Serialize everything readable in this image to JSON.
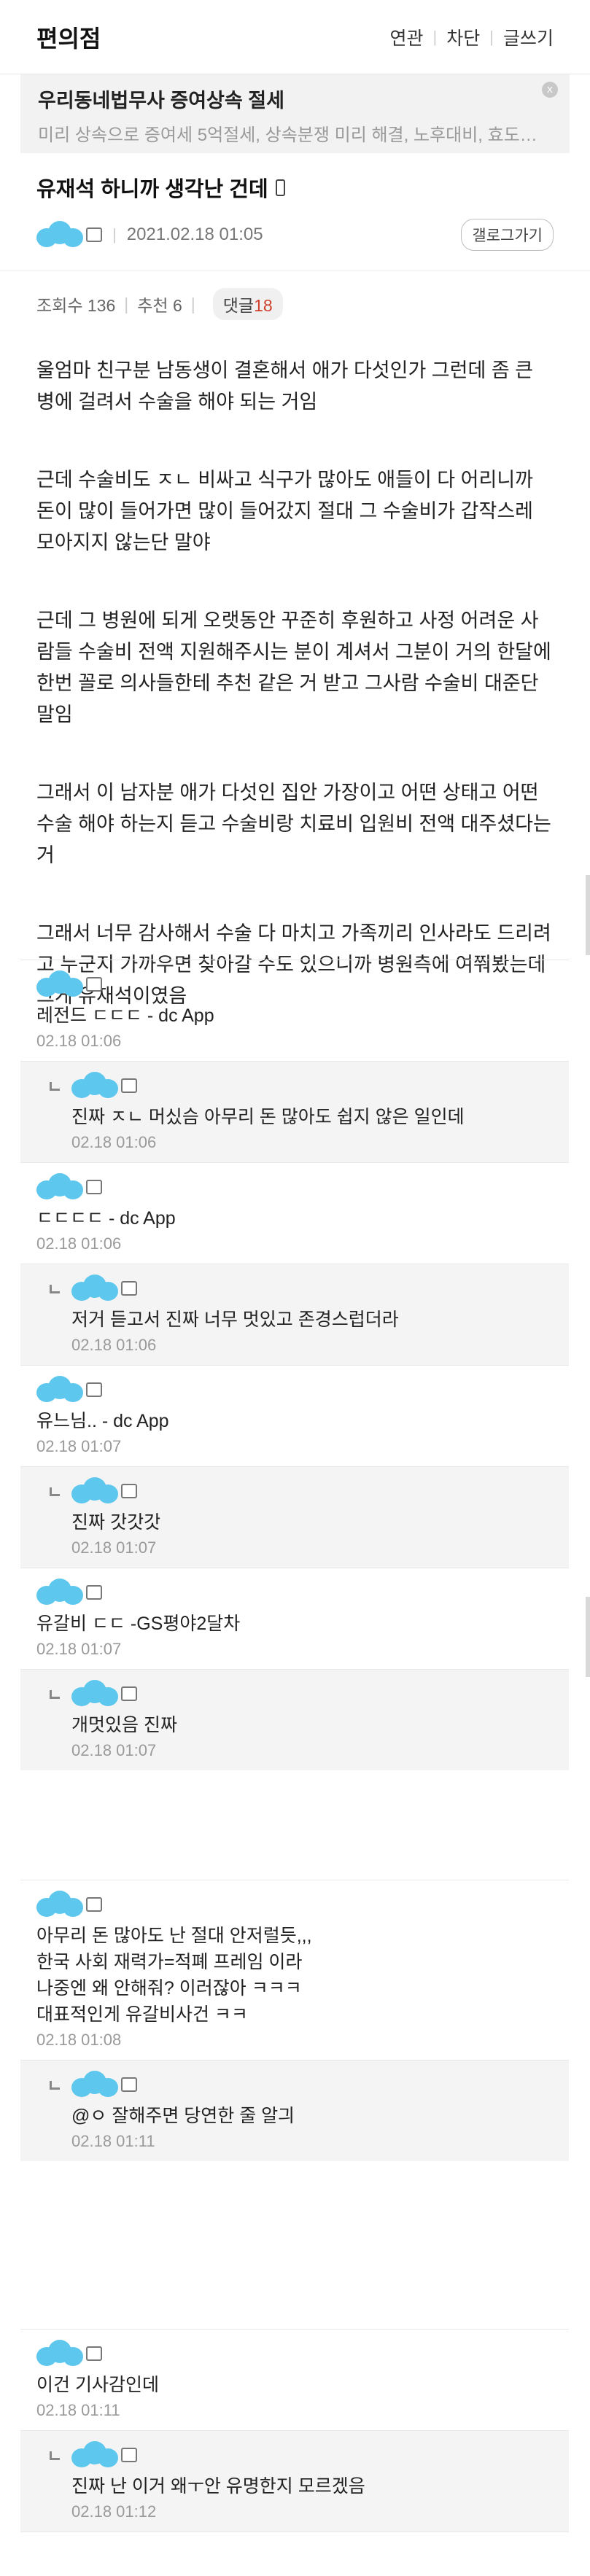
{
  "header": {
    "site_title": "편의점",
    "links": [
      "연관",
      "차단",
      "글쓰기"
    ]
  },
  "ad": {
    "title": "우리동네법무사 증여상속 절세",
    "desc": "미리 상속으로 증여세 5억절세, 상속분쟁 미리 해결, 노후대비, 효도…",
    "close": "x"
  },
  "post": {
    "title": "유재석 하니까 생각난 건데",
    "date": "2021.02.18 01:05",
    "gallery_button": "갤로그가기",
    "views": "조회수 136",
    "recommend": "추천 6",
    "reply_label": "댓글",
    "reply_count": "18",
    "body": [
      "울엄마 친구분 남동생이 결혼해서 애가 다섯인가 그런데 좀 큰 병에 걸려서 수술을 해야 되는 거임",
      "근데 수술비도 ㅈㄴ 비싸고 식구가 많아도 애들이 다 어리니까 돈이 많이 들어가면 많이 들어갔지 절대 그 수술비가 갑작스레 모아지지 않는단 말야",
      "근데 그 병원에 되게 오랫동안 꾸준히 후원하고 사정 어려운 사람들 수술비 전액 지원해주시는 분이 계셔서 그분이 거의 한달에 한번 꼴로 의사들한테 추천 같은 거 받고 그사람 수술비 대준단말임",
      "그래서 이 남자분 애가 다섯인 집안 가장이고 어떤 상태고 어떤 수술 해야 하는지 듣고 수술비랑 치료비 입원비 전액 대주셨다는거",
      "그래서 너무 감사해서 수술 다 마치고 가족끼리 인사라도 드리려고 누군지 가까우면 찾아갈 수도 있으니까 병원측에 여쭤봤는데 그게 유재석이였음"
    ]
  },
  "comments": [
    {
      "text": "레전드 ㄷㄷㄷ - dc App",
      "date": "02.18 01:06",
      "reply": false
    },
    {
      "text": "진짜 ㅈㄴ 머싰슴 아무리 돈 많아도 쉽지 않은 일인데",
      "date": "02.18 01:06",
      "reply": true
    },
    {
      "text": "ㄷㄷㄷㄷ - dc App",
      "date": "02.18 01:06",
      "reply": false
    },
    {
      "text": "저거 듣고서 진짜 너무 멋있고 존경스럽더라",
      "date": "02.18 01:06",
      "reply": true
    },
    {
      "text": "유느님.. - dc App",
      "date": "02.18 01:07",
      "reply": false
    },
    {
      "text": "진짜 갓갓갓",
      "date": "02.18 01:07",
      "reply": true
    },
    {
      "text": "유갈비 ㄷㄷ -GS평야2달차",
      "date": "02.18 01:07",
      "reply": false
    },
    {
      "text": "개멋있음 진짜",
      "date": "02.18 01:07",
      "reply": true
    },
    {
      "text": "아무리 돈 많아도 난 절대 안저럴듯,,,\n한국 사회 재력가=적폐 프레임 이라\n나중엔 왜 안해줘? 이러잖아 ㅋㅋㅋ\n대표적인게 유갈비사건 ㅋㅋ",
      "date": "02.18 01:08",
      "reply": false
    },
    {
      "text": "@ㅇ 잘해주면 당연한 줄 알긔",
      "date": "02.18 01:11",
      "reply": true
    },
    {
      "text": "이건 기사감인데",
      "date": "02.18 01:11",
      "reply": false
    },
    {
      "text": "진짜 난 이거 왜ㅜ안 유명한지 모르겠음",
      "date": "02.18 01:12",
      "reply": true
    }
  ],
  "icons": {
    "avatar": "cloud-avatar-icon",
    "device": "phone-icon",
    "badge": "gallery-badge-icon"
  },
  "colors": {
    "accent": "#5ec7ee",
    "reply_count": "#d0402e",
    "reply_bg": "#f4f4f4"
  }
}
